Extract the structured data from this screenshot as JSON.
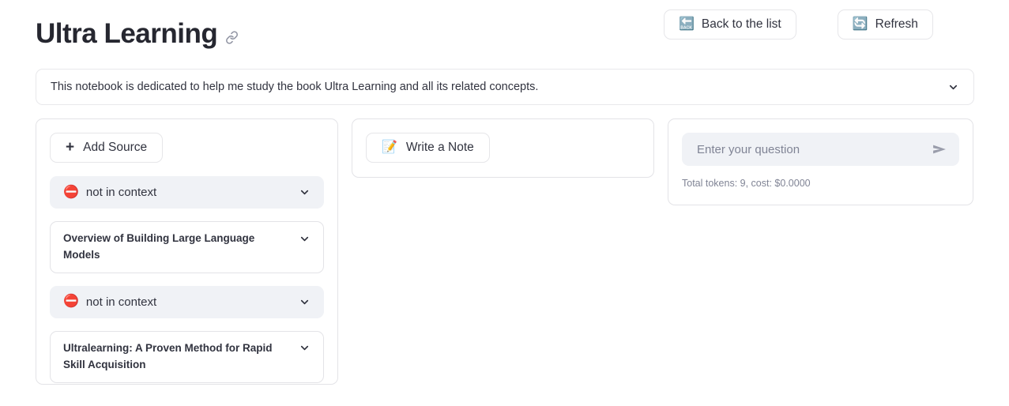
{
  "header": {
    "title": "Ultra Learning",
    "link_icon": "link-icon",
    "buttons": [
      {
        "icon": "🔙",
        "icon_name": "back-arrow-emoji",
        "label": "Back to the list"
      },
      {
        "icon": "🔄",
        "icon_name": "refresh-emoji",
        "label": "Refresh"
      }
    ]
  },
  "description": {
    "text": "This notebook is dedicated to help me study the book Ultra Learning and all its related concepts.",
    "expand_icon": "chevron-down-icon"
  },
  "sources_panel": {
    "add_source_label": "Add Source",
    "add_icon": "plus-icon",
    "items": [
      {
        "type": "status",
        "icon": "⛔",
        "icon_name": "no-entry-emoji",
        "label": "not in context"
      },
      {
        "type": "document",
        "icon": "",
        "icon_name": "",
        "label": "Overview of Building Large Language Models"
      },
      {
        "type": "status",
        "icon": "⛔",
        "icon_name": "no-entry-emoji",
        "label": "not in context"
      },
      {
        "type": "document",
        "icon": "",
        "icon_name": "",
        "label": "Ultralearning: A Proven Method for Rapid Skill Acquisition"
      }
    ]
  },
  "notes_panel": {
    "write_note_label": "Write a Note",
    "write_note_icon": "📝",
    "write_note_icon_name": "memo-emoji"
  },
  "chat_panel": {
    "placeholder": "Enter your question",
    "value": "",
    "send_icon_name": "send-icon",
    "token_info": "Total tokens: 9, cost: $0.0000"
  },
  "colors": {
    "text": "#31333f",
    "title": "#262730",
    "muted": "#808495",
    "panel_border": "#e3e3e7",
    "expander_bg": "#f0f2f6",
    "accent_red": "#d9372a"
  }
}
